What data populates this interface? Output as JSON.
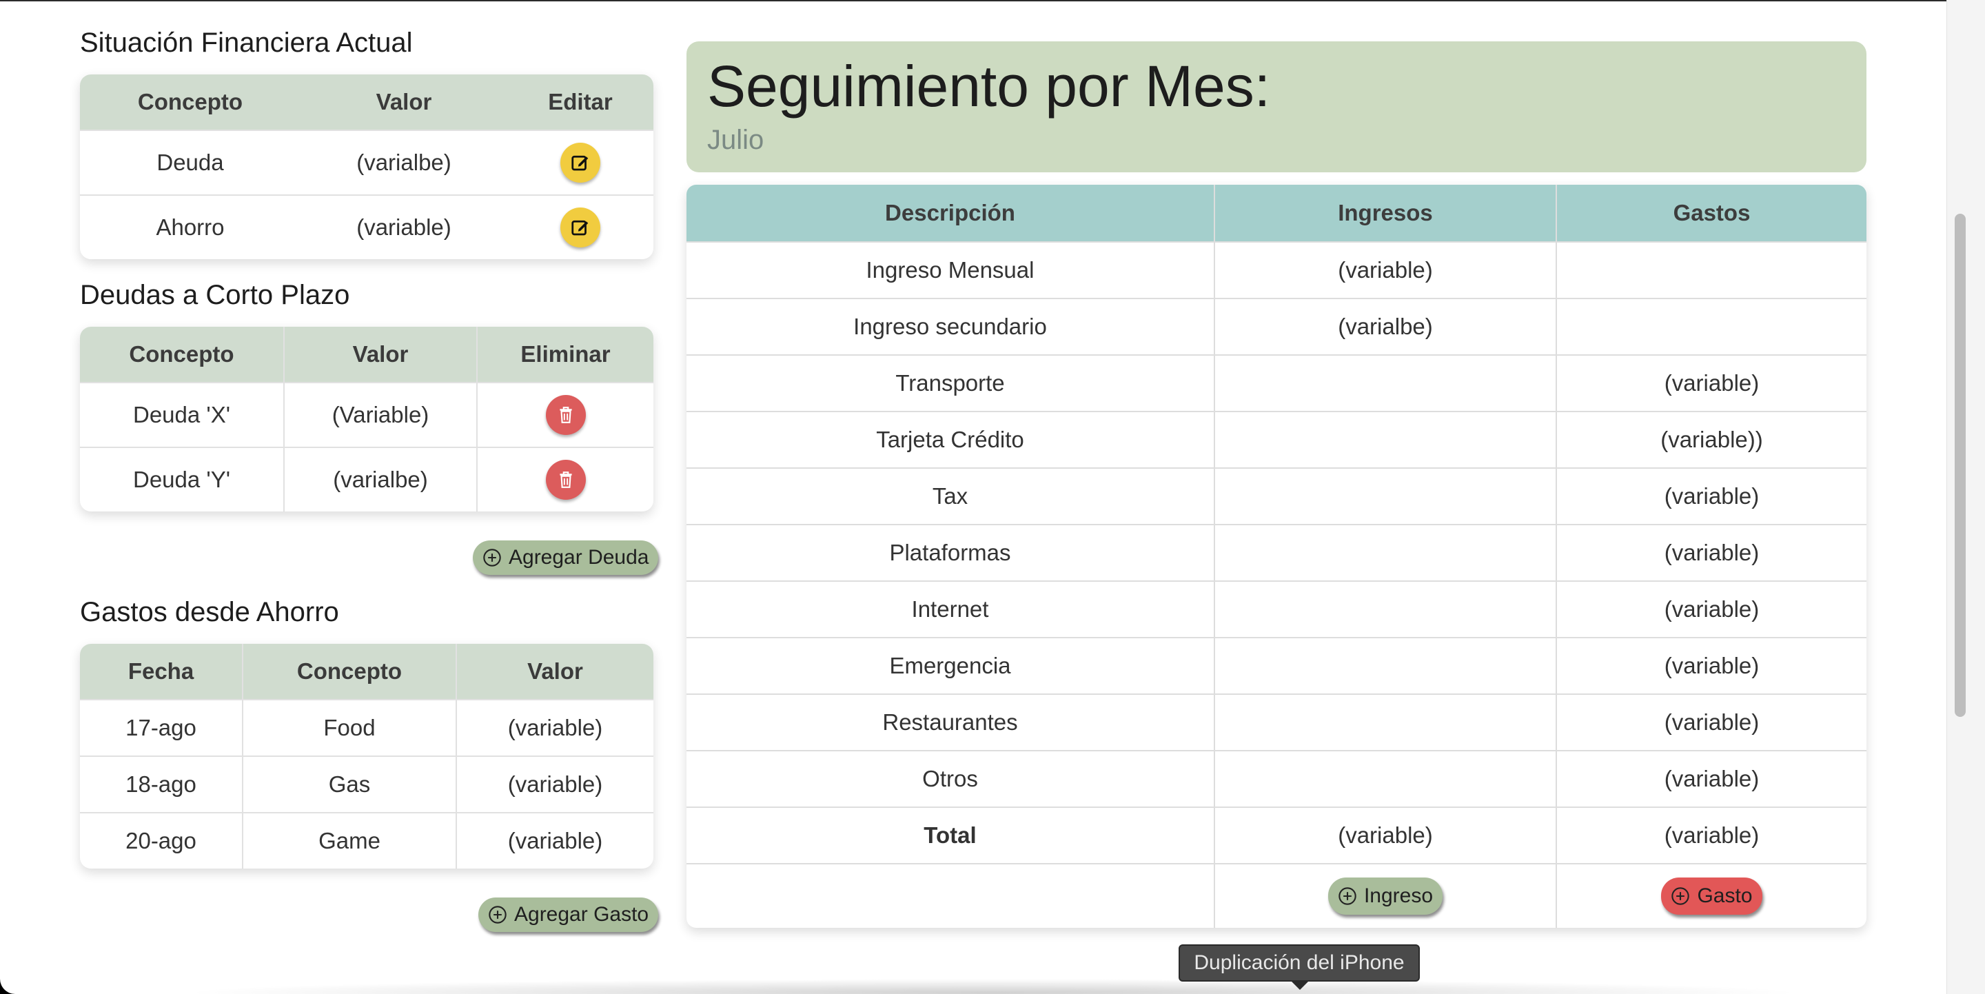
{
  "colors": {
    "table_header_green": "#d0dccf",
    "table_header_teal": "#a4cfcc",
    "month_header_bg": "#cddbc1",
    "edit_button": "#f1cc3f",
    "delete_button": "#dc5c5c",
    "add_button_green": "#a9bd9b",
    "add_button_red": "#e25757"
  },
  "financial_status": {
    "title": "Situación Financiera Actual",
    "headers": [
      "Concepto",
      "Valor",
      "Editar"
    ],
    "rows": [
      {
        "concept": "Deuda",
        "value": "(varialbe)",
        "action_icon": "edit-icon"
      },
      {
        "concept": "Ahorro",
        "value": "(variable)",
        "action_icon": "edit-icon"
      }
    ]
  },
  "short_term_debts": {
    "title": "Deudas a Corto Plazo",
    "headers": [
      "Concepto",
      "Valor",
      "Eliminar"
    ],
    "rows": [
      {
        "concept": "Deuda 'X'",
        "value": "(Variable)",
        "action_icon": "trash-icon"
      },
      {
        "concept": "Deuda 'Y'",
        "value": "(varialbe)",
        "action_icon": "trash-icon"
      }
    ],
    "add_button": "Agregar Deuda"
  },
  "savings_expenses": {
    "title": "Gastos desde Ahorro",
    "headers": [
      "Fecha",
      "Concepto",
      "Valor"
    ],
    "rows": [
      {
        "date": "17-ago",
        "concept": "Food",
        "value": "(variable)"
      },
      {
        "date": "18-ago",
        "concept": "Gas",
        "value": "(variable)"
      },
      {
        "date": "20-ago",
        "concept": "Game",
        "value": "(variable)"
      }
    ],
    "add_button": "Agregar Gasto"
  },
  "monthly_tracking": {
    "title": "Seguimiento por Mes:",
    "month": "Julio",
    "headers": [
      "Descripción",
      "Ingresos",
      "Gastos"
    ],
    "rows": [
      {
        "description": "Ingreso Mensual",
        "income": "(variable)",
        "expense": ""
      },
      {
        "description": "Ingreso secundario",
        "income": "(varialbe)",
        "expense": ""
      },
      {
        "description": "Transporte",
        "income": "",
        "expense": "(variable)"
      },
      {
        "description": "Tarjeta Crédito",
        "income": "",
        "expense": "(variable))"
      },
      {
        "description": "Tax",
        "income": "",
        "expense": "(variable)"
      },
      {
        "description": "Plataformas",
        "income": "",
        "expense": "(variable)"
      },
      {
        "description": "Internet",
        "income": "",
        "expense": "(variable)"
      },
      {
        "description": "Emergencia",
        "income": "",
        "expense": "(variable)"
      },
      {
        "description": "Restaurantes",
        "income": "",
        "expense": "(variable)"
      },
      {
        "description": "Otros",
        "income": "",
        "expense": "(variable)"
      }
    ],
    "total": {
      "label": "Total",
      "income": "(variable)",
      "expense": "(variable)"
    },
    "add_income_button": "Ingreso",
    "add_expense_button": "Gasto"
  },
  "tooltip": "Duplicación del iPhone"
}
